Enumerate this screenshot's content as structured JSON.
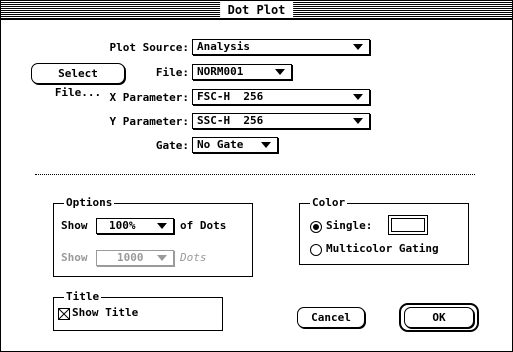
{
  "window": {
    "title": "Dot Plot"
  },
  "plot_source": {
    "label": "Plot Source:",
    "value": "Analysis"
  },
  "select_file_button": "Select File...",
  "file": {
    "label": "File:",
    "value": "NORM001"
  },
  "x_parameter": {
    "label": "X Parameter:",
    "value": "FSC-H  256"
  },
  "y_parameter": {
    "label": "Y Parameter:",
    "value": "SSC-H  256"
  },
  "gate": {
    "label": "Gate:",
    "value": "No Gate"
  },
  "options": {
    "title": "Options",
    "show_percent": {
      "prefix": "Show",
      "value": "100%",
      "suffix": "of Dots"
    },
    "show_count": {
      "prefix": "Show",
      "value": "1000",
      "suffix": "Dots"
    }
  },
  "color": {
    "title": "Color",
    "single_label": "Single:",
    "single_selected": true,
    "multicolor_label": "Multicolor Gating",
    "swatch_color": "#ffffff"
  },
  "title_group": {
    "title": "Title",
    "show_title_label": "Show Title",
    "show_title_checked": true
  },
  "buttons": {
    "cancel": "Cancel",
    "ok": "OK"
  }
}
